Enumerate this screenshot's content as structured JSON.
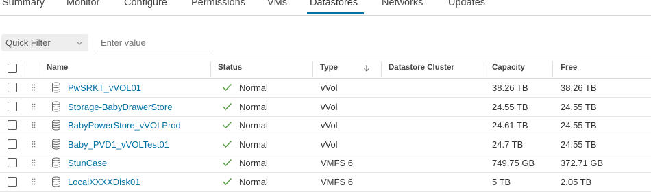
{
  "tabs": [
    {
      "label": "Summary",
      "active": false
    },
    {
      "label": "Monitor",
      "active": false
    },
    {
      "label": "Configure",
      "active": false
    },
    {
      "label": "Permissions",
      "active": false
    },
    {
      "label": "VMs",
      "active": false
    },
    {
      "label": "Datastores",
      "active": true
    },
    {
      "label": "Networks",
      "active": false
    },
    {
      "label": "Updates",
      "active": false
    }
  ],
  "filter": {
    "select_label": "Quick Filter",
    "input_placeholder": "Enter value"
  },
  "table": {
    "columns": [
      "Name",
      "Status",
      "Type",
      "Datastore Cluster",
      "Capacity",
      "Free"
    ],
    "sorted_column": "Type",
    "sort_direction": "descending",
    "rows": [
      {
        "name": "PwSRKT_vVOL01",
        "status": "Normal",
        "type": "vVol",
        "cluster": "",
        "capacity": "38.26 TB",
        "free": "38.26 TB"
      },
      {
        "name": "Storage-BabyDrawerStore",
        "status": "Normal",
        "type": "vVol",
        "cluster": "",
        "capacity": "24.55 TB",
        "free": "24.55 TB"
      },
      {
        "name": "BabyPowerStore_vVOLProd",
        "status": "Normal",
        "type": "vVol",
        "cluster": "",
        "capacity": "24.61 TB",
        "free": "24.55 TB"
      },
      {
        "name": "Baby_PVD1_vVOLTest01",
        "status": "Normal",
        "type": "vVol",
        "cluster": "",
        "capacity": "24.7 TB",
        "free": "24.55 TB"
      },
      {
        "name": "StunCase",
        "status": "Normal",
        "type": "VMFS 6",
        "cluster": "",
        "capacity": "749.75 GB",
        "free": "372.71 GB"
      },
      {
        "name": "LocalXXXXDisk01",
        "status": "Normal",
        "type": "VMFS 6",
        "cluster": "",
        "capacity": "5 TB",
        "free": "2.05 TB"
      }
    ]
  },
  "colors": {
    "accent": "#0072a3",
    "status_ok": "#4f9a3d"
  }
}
